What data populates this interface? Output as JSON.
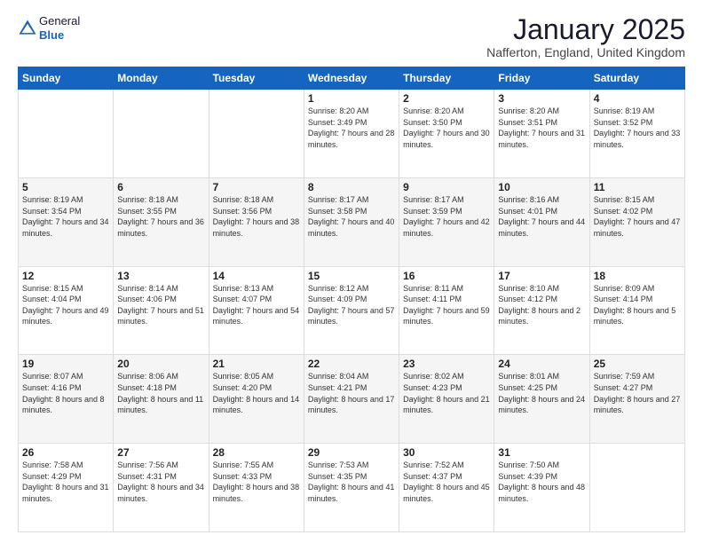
{
  "logo": {
    "general": "General",
    "blue": "Blue"
  },
  "title": "January 2025",
  "subtitle": "Nafferton, England, United Kingdom",
  "days_of_week": [
    "Sunday",
    "Monday",
    "Tuesday",
    "Wednesday",
    "Thursday",
    "Friday",
    "Saturday"
  ],
  "weeks": [
    [
      {
        "day": "",
        "sunrise": "",
        "sunset": "",
        "daylight": ""
      },
      {
        "day": "",
        "sunrise": "",
        "sunset": "",
        "daylight": ""
      },
      {
        "day": "",
        "sunrise": "",
        "sunset": "",
        "daylight": ""
      },
      {
        "day": "1",
        "sunrise": "Sunrise: 8:20 AM",
        "sunset": "Sunset: 3:49 PM",
        "daylight": "Daylight: 7 hours and 28 minutes."
      },
      {
        "day": "2",
        "sunrise": "Sunrise: 8:20 AM",
        "sunset": "Sunset: 3:50 PM",
        "daylight": "Daylight: 7 hours and 30 minutes."
      },
      {
        "day": "3",
        "sunrise": "Sunrise: 8:20 AM",
        "sunset": "Sunset: 3:51 PM",
        "daylight": "Daylight: 7 hours and 31 minutes."
      },
      {
        "day": "4",
        "sunrise": "Sunrise: 8:19 AM",
        "sunset": "Sunset: 3:52 PM",
        "daylight": "Daylight: 7 hours and 33 minutes."
      }
    ],
    [
      {
        "day": "5",
        "sunrise": "Sunrise: 8:19 AM",
        "sunset": "Sunset: 3:54 PM",
        "daylight": "Daylight: 7 hours and 34 minutes."
      },
      {
        "day": "6",
        "sunrise": "Sunrise: 8:18 AM",
        "sunset": "Sunset: 3:55 PM",
        "daylight": "Daylight: 7 hours and 36 minutes."
      },
      {
        "day": "7",
        "sunrise": "Sunrise: 8:18 AM",
        "sunset": "Sunset: 3:56 PM",
        "daylight": "Daylight: 7 hours and 38 minutes."
      },
      {
        "day": "8",
        "sunrise": "Sunrise: 8:17 AM",
        "sunset": "Sunset: 3:58 PM",
        "daylight": "Daylight: 7 hours and 40 minutes."
      },
      {
        "day": "9",
        "sunrise": "Sunrise: 8:17 AM",
        "sunset": "Sunset: 3:59 PM",
        "daylight": "Daylight: 7 hours and 42 minutes."
      },
      {
        "day": "10",
        "sunrise": "Sunrise: 8:16 AM",
        "sunset": "Sunset: 4:01 PM",
        "daylight": "Daylight: 7 hours and 44 minutes."
      },
      {
        "day": "11",
        "sunrise": "Sunrise: 8:15 AM",
        "sunset": "Sunset: 4:02 PM",
        "daylight": "Daylight: 7 hours and 47 minutes."
      }
    ],
    [
      {
        "day": "12",
        "sunrise": "Sunrise: 8:15 AM",
        "sunset": "Sunset: 4:04 PM",
        "daylight": "Daylight: 7 hours and 49 minutes."
      },
      {
        "day": "13",
        "sunrise": "Sunrise: 8:14 AM",
        "sunset": "Sunset: 4:06 PM",
        "daylight": "Daylight: 7 hours and 51 minutes."
      },
      {
        "day": "14",
        "sunrise": "Sunrise: 8:13 AM",
        "sunset": "Sunset: 4:07 PM",
        "daylight": "Daylight: 7 hours and 54 minutes."
      },
      {
        "day": "15",
        "sunrise": "Sunrise: 8:12 AM",
        "sunset": "Sunset: 4:09 PM",
        "daylight": "Daylight: 7 hours and 57 minutes."
      },
      {
        "day": "16",
        "sunrise": "Sunrise: 8:11 AM",
        "sunset": "Sunset: 4:11 PM",
        "daylight": "Daylight: 7 hours and 59 minutes."
      },
      {
        "day": "17",
        "sunrise": "Sunrise: 8:10 AM",
        "sunset": "Sunset: 4:12 PM",
        "daylight": "Daylight: 8 hours and 2 minutes."
      },
      {
        "day": "18",
        "sunrise": "Sunrise: 8:09 AM",
        "sunset": "Sunset: 4:14 PM",
        "daylight": "Daylight: 8 hours and 5 minutes."
      }
    ],
    [
      {
        "day": "19",
        "sunrise": "Sunrise: 8:07 AM",
        "sunset": "Sunset: 4:16 PM",
        "daylight": "Daylight: 8 hours and 8 minutes."
      },
      {
        "day": "20",
        "sunrise": "Sunrise: 8:06 AM",
        "sunset": "Sunset: 4:18 PM",
        "daylight": "Daylight: 8 hours and 11 minutes."
      },
      {
        "day": "21",
        "sunrise": "Sunrise: 8:05 AM",
        "sunset": "Sunset: 4:20 PM",
        "daylight": "Daylight: 8 hours and 14 minutes."
      },
      {
        "day": "22",
        "sunrise": "Sunrise: 8:04 AM",
        "sunset": "Sunset: 4:21 PM",
        "daylight": "Daylight: 8 hours and 17 minutes."
      },
      {
        "day": "23",
        "sunrise": "Sunrise: 8:02 AM",
        "sunset": "Sunset: 4:23 PM",
        "daylight": "Daylight: 8 hours and 21 minutes."
      },
      {
        "day": "24",
        "sunrise": "Sunrise: 8:01 AM",
        "sunset": "Sunset: 4:25 PM",
        "daylight": "Daylight: 8 hours and 24 minutes."
      },
      {
        "day": "25",
        "sunrise": "Sunrise: 7:59 AM",
        "sunset": "Sunset: 4:27 PM",
        "daylight": "Daylight: 8 hours and 27 minutes."
      }
    ],
    [
      {
        "day": "26",
        "sunrise": "Sunrise: 7:58 AM",
        "sunset": "Sunset: 4:29 PM",
        "daylight": "Daylight: 8 hours and 31 minutes."
      },
      {
        "day": "27",
        "sunrise": "Sunrise: 7:56 AM",
        "sunset": "Sunset: 4:31 PM",
        "daylight": "Daylight: 8 hours and 34 minutes."
      },
      {
        "day": "28",
        "sunrise": "Sunrise: 7:55 AM",
        "sunset": "Sunset: 4:33 PM",
        "daylight": "Daylight: 8 hours and 38 minutes."
      },
      {
        "day": "29",
        "sunrise": "Sunrise: 7:53 AM",
        "sunset": "Sunset: 4:35 PM",
        "daylight": "Daylight: 8 hours and 41 minutes."
      },
      {
        "day": "30",
        "sunrise": "Sunrise: 7:52 AM",
        "sunset": "Sunset: 4:37 PM",
        "daylight": "Daylight: 8 hours and 45 minutes."
      },
      {
        "day": "31",
        "sunrise": "Sunrise: 7:50 AM",
        "sunset": "Sunset: 4:39 PM",
        "daylight": "Daylight: 8 hours and 48 minutes."
      },
      {
        "day": "",
        "sunrise": "",
        "sunset": "",
        "daylight": ""
      }
    ]
  ]
}
